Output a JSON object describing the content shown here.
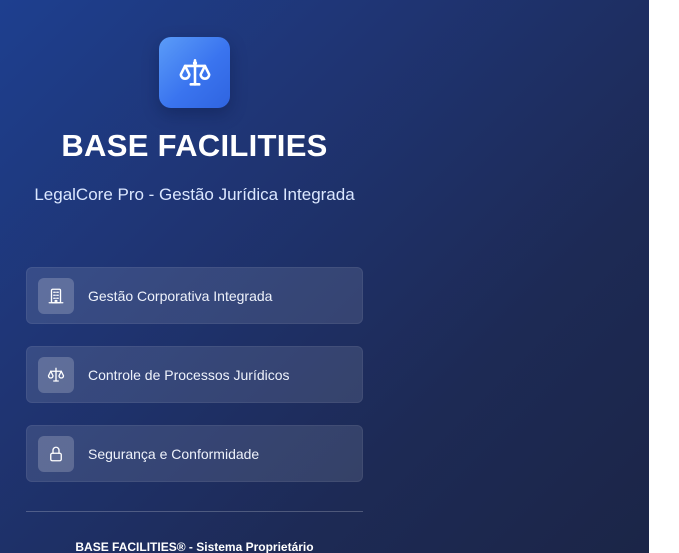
{
  "brand": {
    "title": "BASE FACILITIES",
    "subtitle": "LegalCore Pro - Gestão Jurídica Integrada",
    "logo_icon": "scale-icon",
    "logo_color": "#3a74ef"
  },
  "features": [
    {
      "label": "Gestão Corporativa Integrada",
      "icon": "building-icon"
    },
    {
      "label": "Controle de Processos Jurídicos",
      "icon": "scale-icon"
    },
    {
      "label": "Segurança e Conformidade",
      "icon": "lock-icon"
    }
  ],
  "footer": {
    "text": "BASE FACILITIES® - Sistema Proprietário"
  },
  "colors": {
    "panel_background": "#1e3470",
    "right_background": "#ffffff"
  }
}
